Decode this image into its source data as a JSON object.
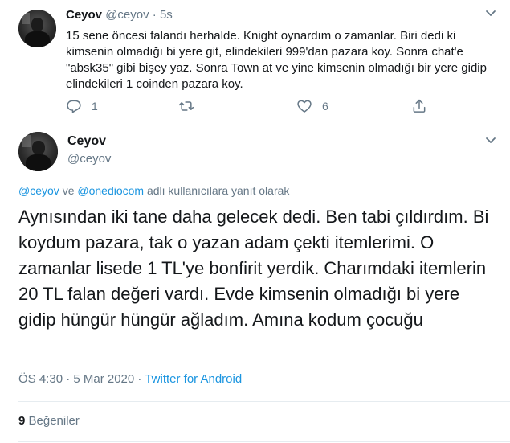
{
  "quoted_tweet": {
    "name": "Ceyov",
    "handle": "@ceyov",
    "sep": "·",
    "time": "5s",
    "text": "15 sene öncesi falandı herhalde. Knight oynardım o zamanlar. Biri dedi ki kimsenin olmadığı bi yere git, elindekileri 999'dan pazara koy. Sonra chat'e \"absk35\" gibi bişey yaz. Sonra Town at ve yine kimsenin olmadığı bir yere gidip elindekileri 1 coinden pazara koy.",
    "actions": {
      "reply_count": "1",
      "retweet_count": "",
      "like_count": "6"
    }
  },
  "main_tweet": {
    "name": "Ceyov",
    "handle": "@ceyov",
    "reply_to": {
      "user1": "@ceyov",
      "and": "ve",
      "user2": "@onediocom",
      "suffix": "adlı kullanıcılara yanıt olarak"
    },
    "text": "Aynısından iki tane daha gelecek dedi. Ben tabi çıldırdım. Bi koydum pazara, tak o yazan adam çekti itemlerimi. O zamanlar lisede 1 TL'ye bonfirit yerdik. Charımdaki itemlerin 20 TL falan değeri vardı. Evde kimsenin olmadığı bi yere gidip hüngür hüngür ağladım. Amına kodum çocuğu",
    "timestamp": "ÖS 4:30 · 5 Mar 2020",
    "meta_sep": " · ",
    "source": "Twitter for Android",
    "likes_count": "9",
    "likes_label": "Beğeniler"
  },
  "icons": {
    "reply": "reply-icon",
    "retweet": "retweet-icon",
    "like": "heart-icon",
    "share": "share-icon",
    "caret": "chevron-down-icon"
  },
  "colors": {
    "link": "#1b95e0",
    "muted": "#657786",
    "text": "#14171a",
    "divider": "#e6ecf0"
  }
}
